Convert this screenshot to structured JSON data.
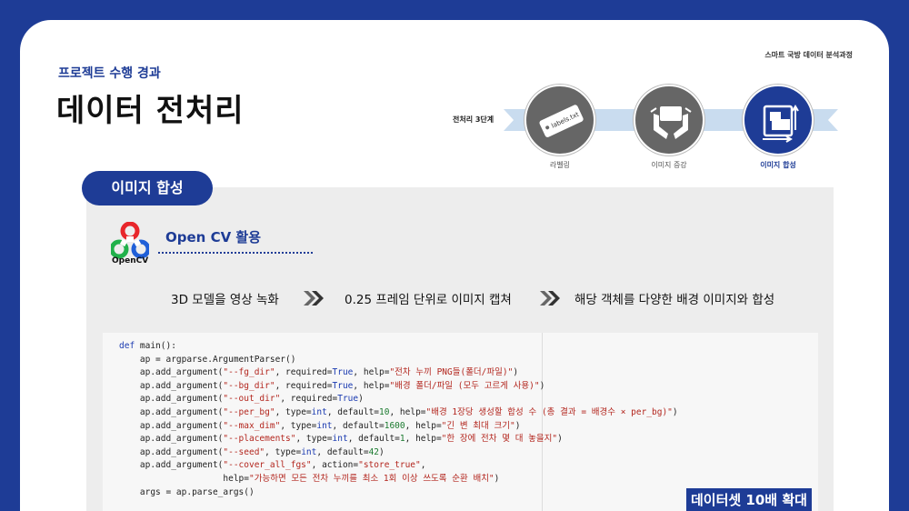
{
  "header": {
    "org": "스마트 국방 데이터 분석과정",
    "subtitle": "프로젝트 수행 경과",
    "title": "데이터 전처리"
  },
  "stage": {
    "label": "전처리 3단계",
    "steps": [
      {
        "caption": "라벨링",
        "icon": "label-tag-icon",
        "tag_text": "labels.txt"
      },
      {
        "caption": "이미지 증강",
        "icon": "hands-image-icon"
      },
      {
        "caption": "이미지 합성",
        "icon": "image-composite-icon"
      }
    ],
    "active_index": 2
  },
  "section": {
    "pill": "이미지 합성",
    "logo_text": "OpenCV",
    "heading": "Open CV 활용"
  },
  "flow": [
    "3D 모델을 영상 녹화",
    "0.25 프레임 단위로 이미지 캡쳐",
    "해당 객체를 다양한 배경 이미지와 합성"
  ],
  "code": {
    "lines": [
      [
        {
          "t": "def ",
          "c": "kw"
        },
        {
          "t": "main():",
          "c": ""
        }
      ],
      [
        {
          "t": "    ap = argparse.ArgumentParser()",
          "c": ""
        }
      ],
      [
        {
          "t": "    ap.add_argument(",
          "c": ""
        },
        {
          "t": "\"--fg_dir\"",
          "c": "str"
        },
        {
          "t": ", required=",
          "c": ""
        },
        {
          "t": "True",
          "c": "kw"
        },
        {
          "t": ", help=",
          "c": ""
        },
        {
          "t": "\"전차 누끼 PNG들(폴더/파일)\"",
          "c": "str"
        },
        {
          "t": ")",
          "c": ""
        }
      ],
      [
        {
          "t": "    ap.add_argument(",
          "c": ""
        },
        {
          "t": "\"--bg_dir\"",
          "c": "str"
        },
        {
          "t": ", required=",
          "c": ""
        },
        {
          "t": "True",
          "c": "kw"
        },
        {
          "t": ", help=",
          "c": ""
        },
        {
          "t": "\"배경 폴더/파일 (모두 고르게 사용)\"",
          "c": "str"
        },
        {
          "t": ")",
          "c": ""
        }
      ],
      [
        {
          "t": "    ap.add_argument(",
          "c": ""
        },
        {
          "t": "\"--out_dir\"",
          "c": "str"
        },
        {
          "t": ", required=",
          "c": ""
        },
        {
          "t": "True",
          "c": "kw"
        },
        {
          "t": ")",
          "c": ""
        }
      ],
      [
        {
          "t": "    ap.add_argument(",
          "c": ""
        },
        {
          "t": "\"--per_bg\"",
          "c": "str"
        },
        {
          "t": ", type=",
          "c": ""
        },
        {
          "t": "int",
          "c": "kw"
        },
        {
          "t": ", default=",
          "c": ""
        },
        {
          "t": "10",
          "c": "num"
        },
        {
          "t": ", help=",
          "c": ""
        },
        {
          "t": "\"배경 1장당 생성할 합성 수 (총 결과 = 배경수 × per_bg)\"",
          "c": "str"
        },
        {
          "t": ")",
          "c": ""
        }
      ],
      [
        {
          "t": "    ap.add_argument(",
          "c": ""
        },
        {
          "t": "\"--max_dim\"",
          "c": "str"
        },
        {
          "t": ", type=",
          "c": ""
        },
        {
          "t": "int",
          "c": "kw"
        },
        {
          "t": ", default=",
          "c": ""
        },
        {
          "t": "1600",
          "c": "num"
        },
        {
          "t": ", help=",
          "c": ""
        },
        {
          "t": "\"긴 변 최대 크기\"",
          "c": "str"
        },
        {
          "t": ")",
          "c": ""
        }
      ],
      [
        {
          "t": "    ap.add_argument(",
          "c": ""
        },
        {
          "t": "\"--placements\"",
          "c": "str"
        },
        {
          "t": ", type=",
          "c": ""
        },
        {
          "t": "int",
          "c": "kw"
        },
        {
          "t": ", default=",
          "c": ""
        },
        {
          "t": "1",
          "c": "num"
        },
        {
          "t": ", help=",
          "c": ""
        },
        {
          "t": "\"한 장에 전차 몇 대 놓을지\"",
          "c": "str"
        },
        {
          "t": ")",
          "c": ""
        }
      ],
      [
        {
          "t": "    ap.add_argument(",
          "c": ""
        },
        {
          "t": "\"--seed\"",
          "c": "str"
        },
        {
          "t": ", type=",
          "c": ""
        },
        {
          "t": "int",
          "c": "kw"
        },
        {
          "t": ", default=",
          "c": ""
        },
        {
          "t": "42",
          "c": "num"
        },
        {
          "t": ")",
          "c": ""
        }
      ],
      [
        {
          "t": "    ap.add_argument(",
          "c": ""
        },
        {
          "t": "\"--cover_all_fgs\"",
          "c": "str"
        },
        {
          "t": ", action=",
          "c": ""
        },
        {
          "t": "\"store_true\"",
          "c": "str"
        },
        {
          "t": ",",
          "c": ""
        }
      ],
      [
        {
          "t": "                    help=",
          "c": ""
        },
        {
          "t": "\"가능하면 모든 전차 누끼를 최소 1회 이상 쓰도록 순환 배치\"",
          "c": "str"
        },
        {
          "t": ")",
          "c": ""
        }
      ],
      [
        {
          "t": "    args = ap.parse_args()",
          "c": ""
        }
      ]
    ]
  },
  "badge": "데이터셋 10배 확대",
  "colors": {
    "brand": "#1e3c96",
    "panel": "#ededed",
    "step_inactive": "#666666"
  }
}
